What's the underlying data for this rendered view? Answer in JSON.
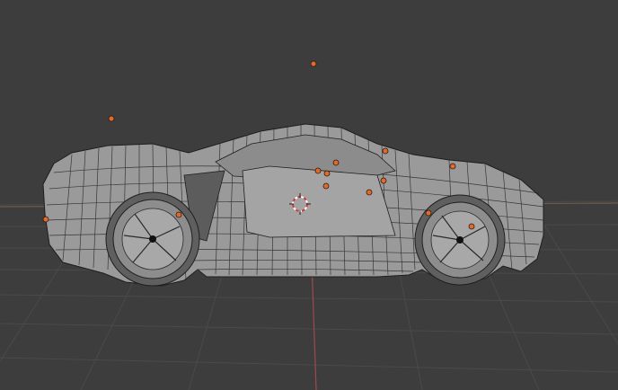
{
  "viewport": {
    "background": "#3d3d3d",
    "grid_color": "#4a4a4a",
    "x_axis_color": "#7a5a5a",
    "y_axis_color": "#9d4a4f"
  },
  "model": {
    "body_color": "#9a9a9a",
    "wire_color": "#1d1d1d",
    "light_color": "#e06a2a",
    "light_count": 14
  },
  "gizmo": {
    "name": "3d-cursor",
    "colors": [
      "#d23b3b",
      "#ffffff"
    ]
  }
}
